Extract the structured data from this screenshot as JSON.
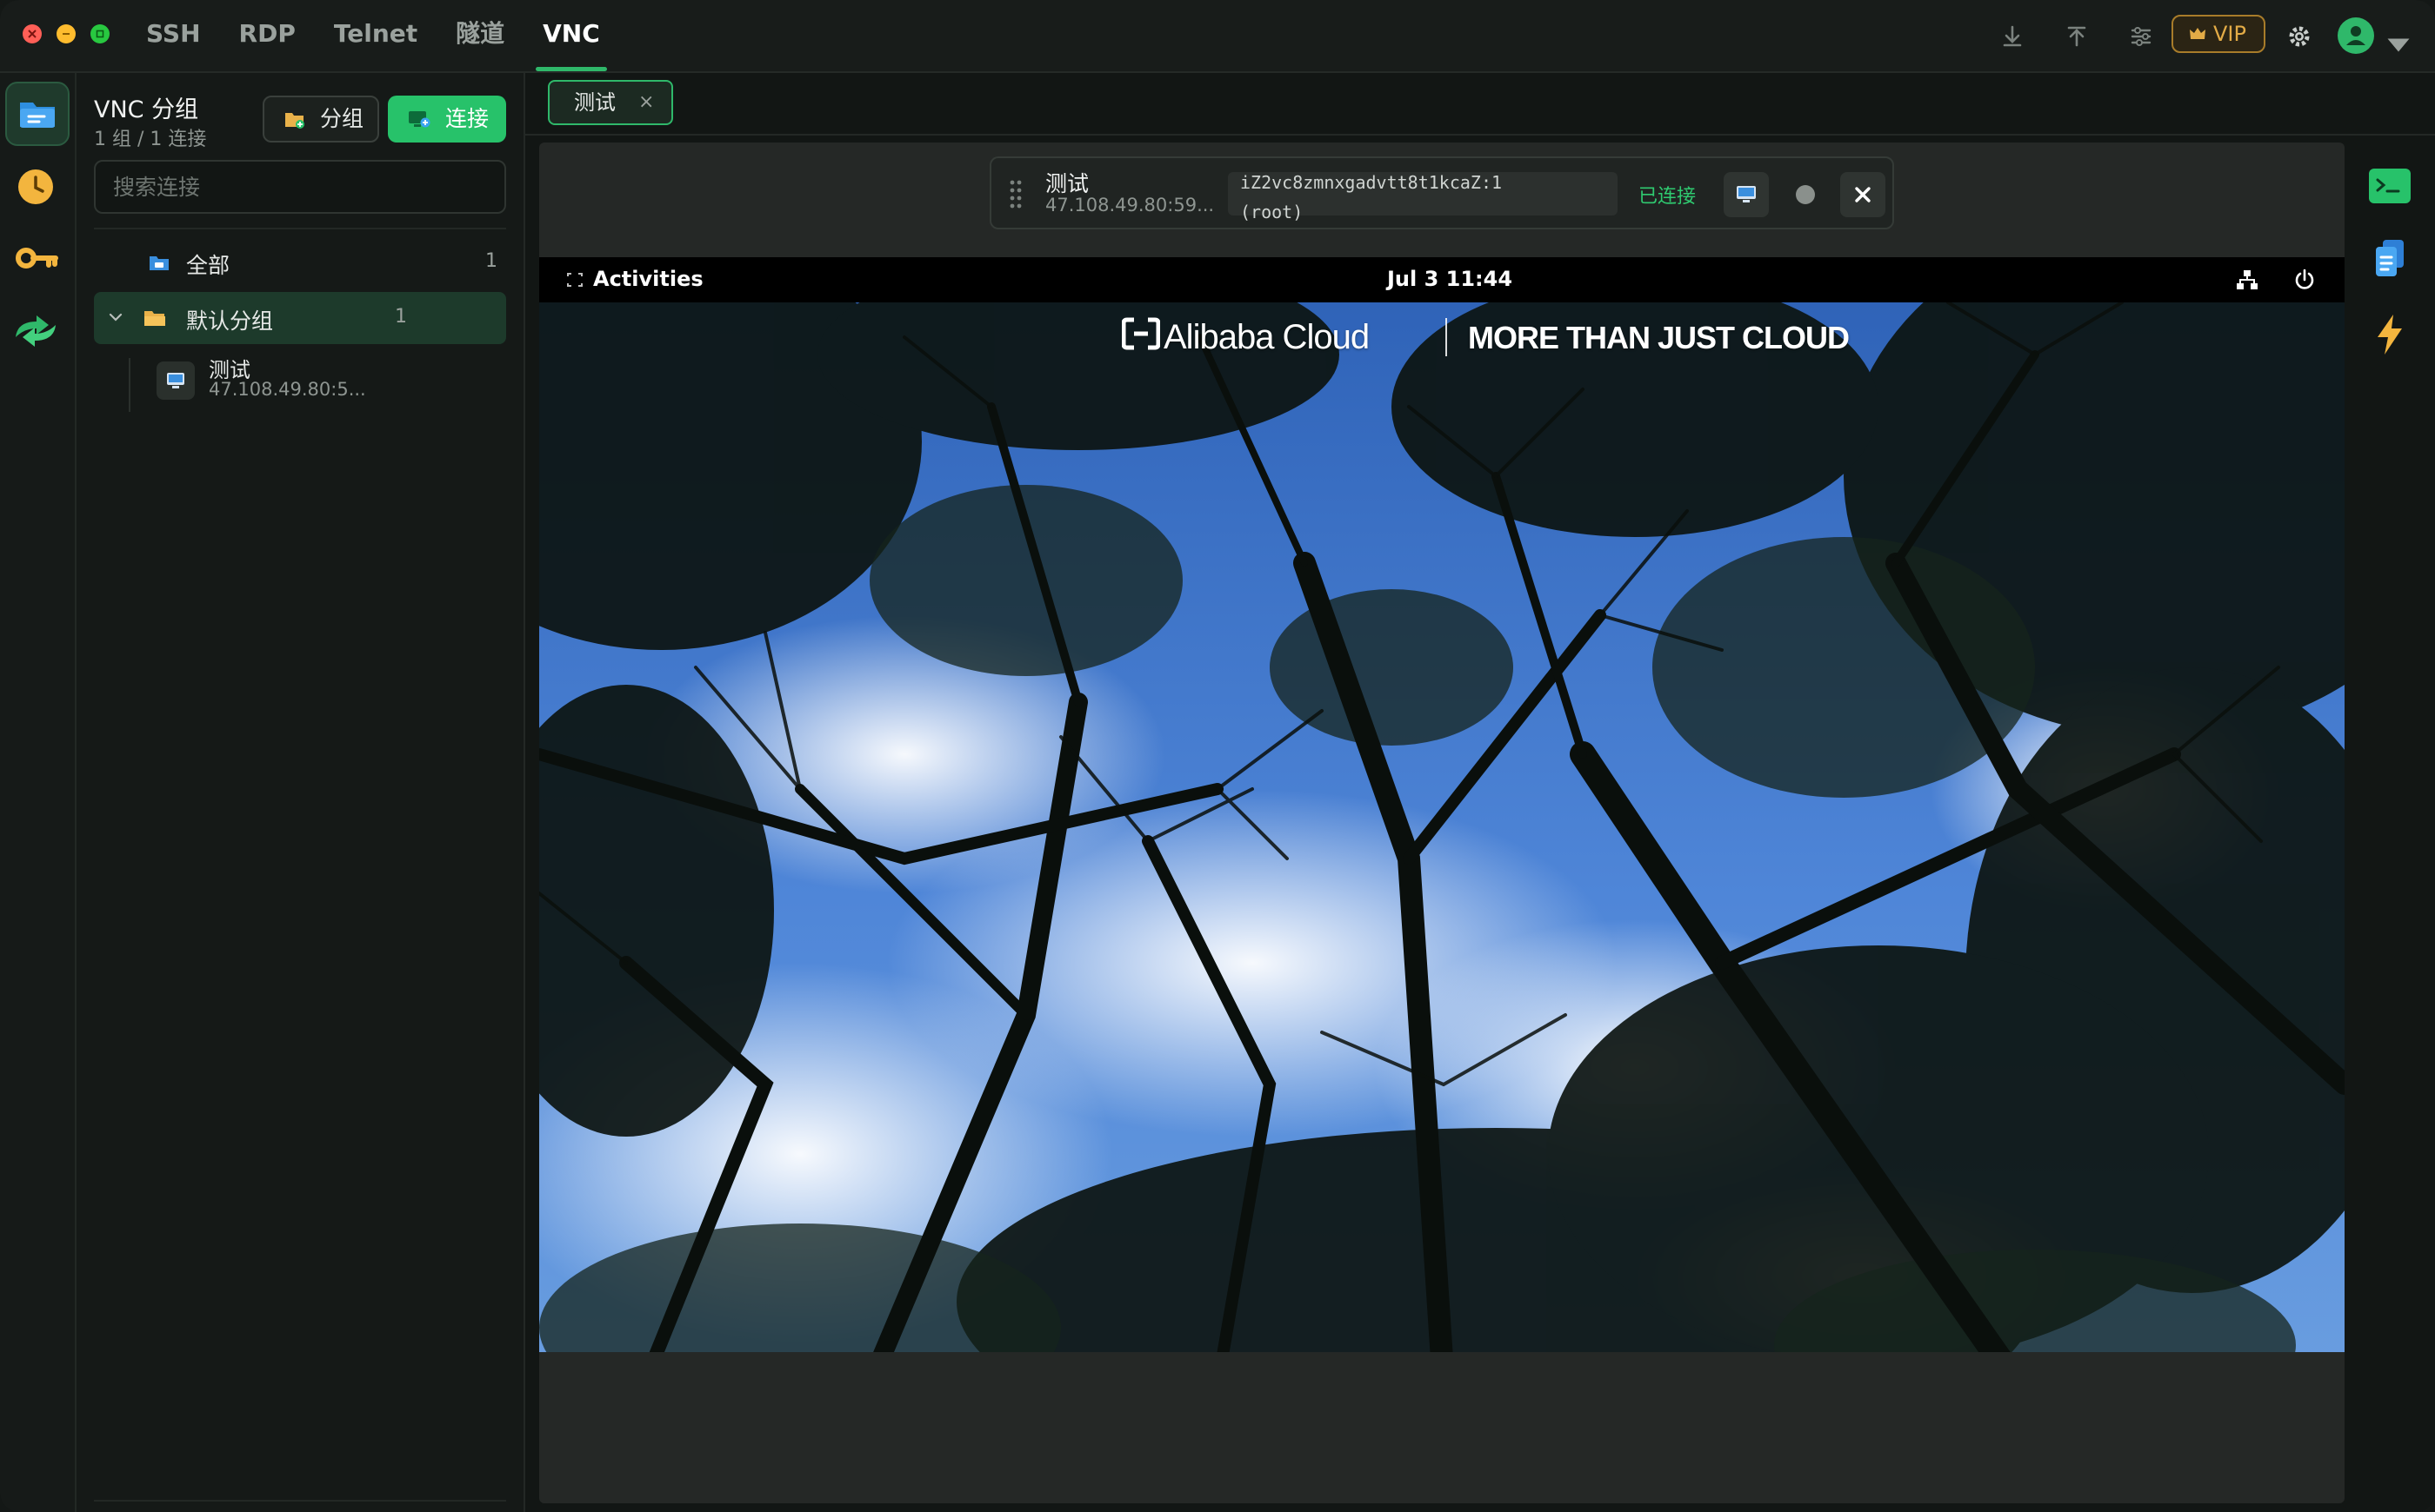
{
  "protocols": [
    {
      "label": "SSH",
      "active": false
    },
    {
      "label": "RDP",
      "active": false
    },
    {
      "label": "Telnet",
      "active": false
    },
    {
      "label": "隧道",
      "active": false
    },
    {
      "label": "VNC",
      "active": true
    }
  ],
  "header": {
    "vip_label": "VIP",
    "icons": [
      "download-icon",
      "upload-icon",
      "sliders-icon",
      "settings-icon",
      "avatar-icon"
    ]
  },
  "colors": {
    "accent": "#27c26a",
    "selected_row": "#1d3a2b",
    "vip_gold": "#e3ab46",
    "status_connected": "#2fca70"
  },
  "sidebar": {
    "rail_icons": [
      "folder-icon",
      "clock-icon",
      "key-icon",
      "sync-icon"
    ],
    "title": "VNC 分组",
    "subtitle": "1 组 / 1 连接",
    "group_button": "分组",
    "connect_button": "连接",
    "search_placeholder": "搜索连接",
    "tree": {
      "all": {
        "label": "全部",
        "count": "1"
      },
      "group": {
        "label": "默认分组",
        "count": "1",
        "expanded": true
      },
      "connection": {
        "name": "测试",
        "address": "47.108.49.80:5..."
      }
    }
  },
  "tabs": [
    {
      "label": "测试",
      "close": "×"
    }
  ],
  "session": {
    "name": "测试",
    "address": "47.108.49.80:59...",
    "host_line1": "iZ2vc8zmnxgadvtt8t1kcaZ:1",
    "host_line2": "(root)",
    "status": "已连接"
  },
  "remote": {
    "activities": "Activities",
    "clock": "Jul 3  11:44",
    "brand": "Alibaba Cloud",
    "slogan": "MORE THAN JUST CLOUD"
  },
  "right_rail_icons": [
    "terminal-icon",
    "files-icon",
    "lightning-icon"
  ]
}
